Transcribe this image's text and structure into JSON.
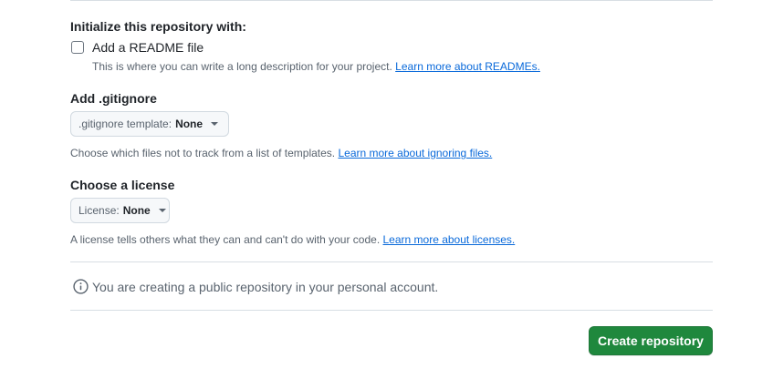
{
  "initialize": {
    "heading": "Initialize this repository with:",
    "readme": {
      "label": "Add a README file",
      "checked": false,
      "help": "This is where you can write a long description for your project.",
      "link": "Learn more about READMEs."
    }
  },
  "gitignore": {
    "heading": "Add .gitignore",
    "select_label": ".gitignore template:",
    "select_value": "None",
    "help": "Choose which files not to track from a list of templates.",
    "link": "Learn more about ignoring files."
  },
  "license": {
    "heading": "Choose a license",
    "select_label": "License:",
    "select_value": "None",
    "help": "A license tells others what they can and can't do with your code.",
    "link": "Learn more about licenses."
  },
  "notice": {
    "icon": "info-icon",
    "text": "You are creating a public repository in your personal account."
  },
  "actions": {
    "create_label": "Create repository"
  },
  "colors": {
    "primary_button": "#1f883d",
    "link": "#0969da",
    "divider": "#d8dee4"
  }
}
